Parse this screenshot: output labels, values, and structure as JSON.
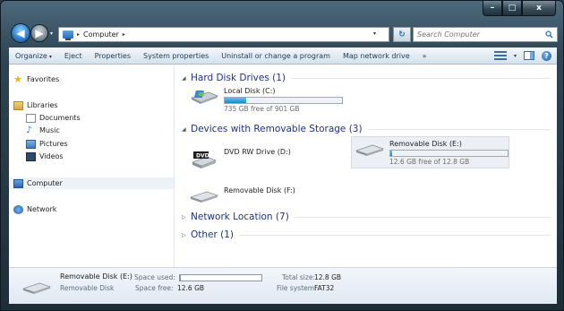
{
  "window": {
    "caption": {
      "minimize": "–",
      "maximize": "□",
      "close": "x"
    }
  },
  "address": {
    "path": "Computer",
    "separator": "▸",
    "refresh_glyph": "↻",
    "search_placeholder": "Search Computer"
  },
  "toolbar": {
    "items": [
      "Organize",
      "Eject",
      "Properties",
      "System properties",
      "Uninstall or change a program",
      "Map network drive",
      "»"
    ],
    "organize_arrow": "▾",
    "help": "?"
  },
  "sidebar": {
    "favorites": "Favorites",
    "libraries": "Libraries",
    "documents": "Documents",
    "music": "Music",
    "pictures": "Pictures",
    "videos": "Videos",
    "computer": "Computer",
    "network": "Network"
  },
  "groups": {
    "hard_disk": "Hard Disk Drives (1)",
    "removable": "Devices with Removable Storage (3)",
    "network_location": "Network Location (7)",
    "other": "Other (1)"
  },
  "drives": {
    "local_c": {
      "name": "Local Disk (C:)",
      "free": "735 GB free of 901 GB",
      "used_fraction": 0.184
    },
    "dvd": {
      "name": "DVD RW Drive (D:)",
      "label": "DVD"
    },
    "removable_e": {
      "name": "Removable Disk (E:)",
      "free": "12.6 GB free of 12.8 GB",
      "used_fraction": 0.016
    },
    "removable_f": {
      "name": "Removable Disk (F:)"
    }
  },
  "details": {
    "name": "Removable Disk (E:)",
    "type": "Removable Disk",
    "space_used_label": "Space used:",
    "space_free_label": "Space free:",
    "space_free_value": "12.6 GB",
    "total_size_label": "Total size:",
    "total_size_value": "12.8 GB",
    "file_system_label": "File system:",
    "file_system_value": "FAT32",
    "used_fraction": 0.016
  },
  "colors": {
    "group_title": "#1e3287",
    "progress_fill": "#1f88c9",
    "selection": "#eceff3"
  }
}
